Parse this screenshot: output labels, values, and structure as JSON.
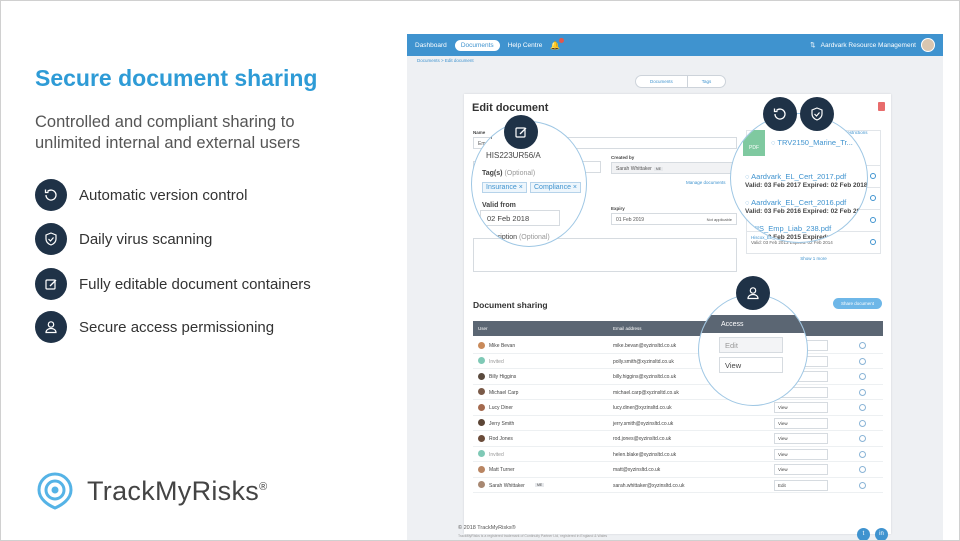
{
  "slide": {
    "headline": "Secure document sharing",
    "subhead": "Controlled and compliant sharing to unlimited internal and external users",
    "features": [
      {
        "label": "Automatic  version control",
        "icon": "history-icon"
      },
      {
        "label": "Daily virus scanning",
        "icon": "shield-icon"
      },
      {
        "label": "Fully editable document containers",
        "icon": "edit-icon"
      },
      {
        "label": "Secure access permissioning",
        "icon": "user-icon"
      }
    ],
    "logo_text": "TrackMyRisks",
    "logo_mark": "®"
  },
  "app": {
    "nav": {
      "dashboard": "Dashboard",
      "documents": "Documents",
      "help": "Help Centre",
      "org": "Aardvark Resource Management"
    },
    "breadcrumb": "Documents  >  Edit document",
    "tabs": [
      "Documents",
      "Tags"
    ],
    "edit": {
      "title": "Edit document",
      "name_label": "Name",
      "name_value": "Employers Liability Certificate",
      "ref_value": "HIS223UR56/A",
      "created_label": "Created by",
      "created_value": "Sarah Whittaker",
      "me": "ME",
      "tags_label": "Tag(s)",
      "tags_optional": "(Optional)",
      "tags": [
        "Insurance",
        "Compliance"
      ],
      "manage": "Manage documents",
      "valid_label": "Valid from",
      "valid_value": "02 Feb 2018",
      "expiry_label": "Expiry",
      "expiry_value": "01 Feb 2019",
      "not_applicable": "Not applicable",
      "desc_label": "Description",
      "desc_optional": "(Optional)",
      "restrictions": "Restrictions",
      "upload_file": "TRV2150_Marine_Tr...",
      "pdf": "PDF",
      "files": [
        {
          "name": "Aardvark_EL_Cert_2017.pdf",
          "dates": "Valid: 03 Feb 2017 Expired: 02 Feb 2018"
        },
        {
          "name": "Aardvark_EL_Cert_2016.pdf",
          "dates": "Valid: 03 Feb 2016 Expired: 02 Feb 2017"
        },
        {
          "name": "HIS_Emp_Liab_238.pdf",
          "dates": "Valid: 03 Feb 2015 Expired: 02 F..."
        },
        {
          "name": "Hiscox_EL_Certificate.pdf",
          "dates": "Valid: 03 Feb 2013 Expired: 02 Feb 2014"
        }
      ],
      "show_more": "Show 1 more"
    },
    "sharing": {
      "title": "Document sharing",
      "share_button": "Share document",
      "col_user": "User",
      "col_email": "Email address",
      "col_access": "Access",
      "rows": [
        {
          "user": "Mike Bevan",
          "email": "mike.bevan@xyzinsltd.co.uk",
          "access": "Edit",
          "dot": "#c98a5a",
          "invited": false
        },
        {
          "user": "Invited",
          "email": "polly.smith@xyzinsltd.co.uk",
          "access": "View",
          "dot": "#7fc9b6",
          "invited": true
        },
        {
          "user": "Billy Higgins",
          "email": "billy.higgins@xyzinsltd.co.uk",
          "access": "View",
          "dot": "#5a4a3e",
          "invited": false
        },
        {
          "user": "Michael Carp",
          "email": "michael.carp@xyzinsltd.co.uk",
          "access": "View",
          "dot": "#7a5a48",
          "invited": false
        },
        {
          "user": "Lucy Diner",
          "email": "lucy.diner@xyzinsltd.co.uk",
          "access": "View",
          "dot": "#a46a4e",
          "invited": false
        },
        {
          "user": "Jerry Smith",
          "email": "jerry.smith@xyzinsltd.co.uk",
          "access": "View",
          "dot": "#5c4536",
          "invited": false
        },
        {
          "user": "Rod Jones",
          "email": "rod.jones@xyzinsltd.co.uk",
          "access": "View",
          "dot": "#6b4c3a",
          "invited": false
        },
        {
          "user": "Invited",
          "email": "helen.blake@xyzinsltd.co.uk",
          "access": "View",
          "dot": "#7fc9b6",
          "invited": true
        },
        {
          "user": "Matt Turner",
          "email": "matt@xyzinsltd.co.uk",
          "access": "View",
          "dot": "#b98562",
          "invited": false
        },
        {
          "user": "Sarah Whittaker",
          "email": "sarah.whittaker@xyzinsltd.co.uk",
          "access": "Edit",
          "dot": "#a88872",
          "invited": false
        }
      ],
      "mag_access": [
        "Edit",
        "View"
      ]
    },
    "footer": {
      "copyright": "© 2018 TrackMyRisks®",
      "sub": "TrackMyRisks is a registered trademark of Continuity Partner Ltd, registered in England & Wales"
    }
  },
  "colors": {
    "accent": "#2e9bd6",
    "dark": "#1f3247",
    "nav": "#3f93cf"
  }
}
